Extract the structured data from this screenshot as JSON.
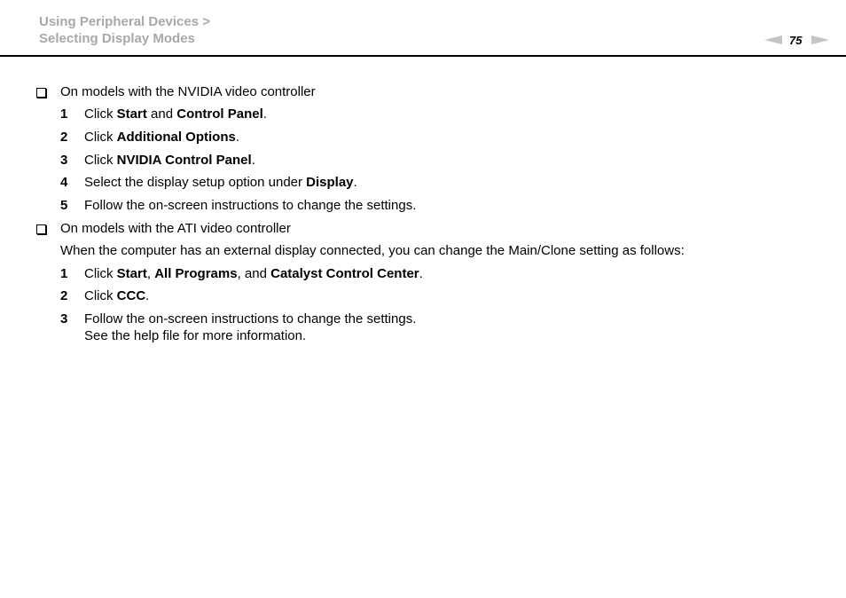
{
  "header": {
    "breadcrumb_parent": "Using Peripheral Devices >",
    "breadcrumb_current": "Selecting Display Modes",
    "page_number": "75",
    "prev_icon": "triangle-left-icon",
    "next_icon": "triangle-right-icon"
  },
  "sections": [
    {
      "bullet_icon": "checkbox-icon",
      "title": "On models with the NVIDIA video controller",
      "steps": [
        {
          "num": "1",
          "parts": [
            [
              "Click ",
              false
            ],
            [
              "Start",
              true
            ],
            [
              " and ",
              false
            ],
            [
              "Control Panel",
              true
            ],
            [
              ".",
              false
            ]
          ]
        },
        {
          "num": "2",
          "parts": [
            [
              "Click ",
              false
            ],
            [
              "Additional Options",
              true
            ],
            [
              ".",
              false
            ]
          ]
        },
        {
          "num": "3",
          "parts": [
            [
              "Click ",
              false
            ],
            [
              "NVIDIA Control Panel",
              true
            ],
            [
              ".",
              false
            ]
          ]
        },
        {
          "num": "4",
          "parts": [
            [
              "Select the display setup option under ",
              false
            ],
            [
              "Display",
              true
            ],
            [
              ".",
              false
            ]
          ]
        },
        {
          "num": "5",
          "parts": [
            [
              "Follow the on-screen instructions to change the settings.",
              false
            ]
          ]
        }
      ]
    },
    {
      "bullet_icon": "checkbox-icon",
      "title": "On models with the ATI video controller",
      "intro": "When the computer has an external display connected, you can change the Main/Clone setting as follows:",
      "steps": [
        {
          "num": "1",
          "parts": [
            [
              "Click ",
              false
            ],
            [
              "Start",
              true
            ],
            [
              ", ",
              false
            ],
            [
              "All Programs",
              true
            ],
            [
              ", and ",
              false
            ],
            [
              "Catalyst Control Center",
              true
            ],
            [
              ".",
              false
            ]
          ]
        },
        {
          "num": "2",
          "parts": [
            [
              "Click ",
              false
            ],
            [
              "CCC",
              true
            ],
            [
              ".",
              false
            ]
          ]
        },
        {
          "num": "3",
          "parts": [
            [
              "Follow the on-screen instructions to change the settings.",
              false
            ]
          ],
          "extra": "See the help file for more information."
        }
      ]
    }
  ]
}
